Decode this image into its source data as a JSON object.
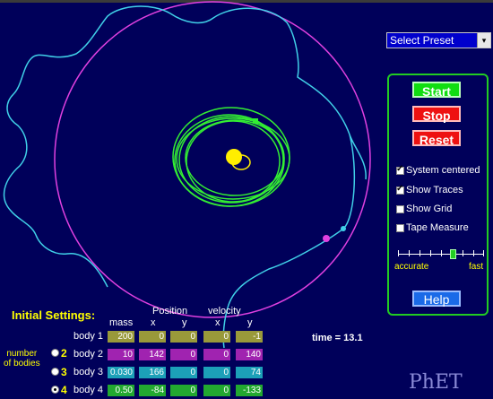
{
  "preset": {
    "label": "Select Preset",
    "arrow": "▾"
  },
  "controls": {
    "start": "Start",
    "stop": "Stop",
    "reset": "Reset",
    "system_centered": "System centered",
    "show_traces": "Show Traces",
    "show_grid": "Show Grid",
    "tape_measure": "Tape Measure",
    "accurate": "accurate",
    "fast": "fast",
    "help": "Help",
    "states": {
      "system_centered": true,
      "show_traces": true,
      "show_grid": false,
      "tape_measure": false
    },
    "speed_fraction": 0.65
  },
  "initial": {
    "title": "Initial Settings:",
    "position_header": "Position",
    "velocity_header": "velocity",
    "mass_header": "mass",
    "x_header": "x",
    "y_header": "y",
    "vx_header": "x",
    "vy_header": "y",
    "number_of_bodies_1": "number",
    "number_of_bodies_2": "of bodies",
    "selected_count": "4",
    "bodies": [
      {
        "label": "body 1",
        "radio": "",
        "mass": "200",
        "x": "0",
        "y": "0",
        "vx": "0",
        "vy": "-1",
        "color": "#99993a"
      },
      {
        "label": "body 2",
        "radio": "2",
        "mass": "10",
        "x": "142",
        "y": "0",
        "vx": "0",
        "vy": "140",
        "color": "#a023b0"
      },
      {
        "label": "body 3",
        "radio": "3",
        "mass": "0.030",
        "x": "166",
        "y": "0",
        "vx": "0",
        "vy": "74",
        "color": "#1ca0b8"
      },
      {
        "label": "body 4",
        "radio": "4",
        "mass": "0.50",
        "x": "-84",
        "y": "0",
        "vx": "0",
        "vy": "-133",
        "color": "#22a830"
      }
    ]
  },
  "time": {
    "label": "time =",
    "value": "13.1"
  },
  "logo": "PhET",
  "colors": {
    "background": "#00005a",
    "orbit_body2": "#e040e0",
    "orbit_body3": "#40d0e8",
    "orbit_body4": "#33ee33",
    "body1": "#ffee00",
    "panel_border": "#22cc22",
    "accent_yellow": "#ffff00"
  }
}
